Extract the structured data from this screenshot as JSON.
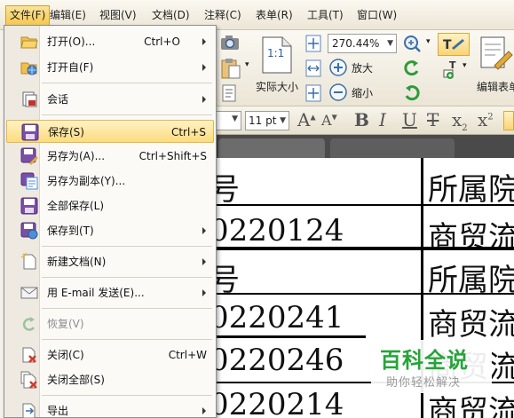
{
  "menubar": {
    "file": "文件(F)",
    "edit": "编辑(E)",
    "view": "视图(V)",
    "document": "文档(D)",
    "comment": "注释(C)",
    "form": "表单(R)",
    "tools": "工具(T)",
    "window": "窗口(W)"
  },
  "file_menu": {
    "open": {
      "label": "打开(O)...",
      "shortcut": "Ctrl+O"
    },
    "open_from": {
      "label": "打开自(F)"
    },
    "session": {
      "label": "会话"
    },
    "save": {
      "label": "保存(S)",
      "shortcut": "Ctrl+S"
    },
    "save_as": {
      "label": "另存为(A)...",
      "shortcut": "Ctrl+Shift+S"
    },
    "save_copy": {
      "label": "另存为副本(Y)..."
    },
    "save_all": {
      "label": "全部保存(L)"
    },
    "save_to": {
      "label": "保存到(T)"
    },
    "new_doc": {
      "label": "新建文档(N)"
    },
    "email": {
      "label": "用 E-mail 发送(E)..."
    },
    "revert": {
      "label": "恢复(V)"
    },
    "close": {
      "label": "关闭(C)",
      "shortcut": "Ctrl+W"
    },
    "close_all": {
      "label": "关闭全部(S)"
    },
    "export": {
      "label": "导出"
    }
  },
  "ribbon": {
    "zoom_value": "270.44%",
    "actual_size_label": "实际大小",
    "zoom_in_label": "放大",
    "zoom_out_label": "缩小",
    "edit_form_label": "编辑表单",
    "page_icon_text": "1:1"
  },
  "format_bar": {
    "font_size": "11 pt"
  },
  "document": {
    "rows": [
      {
        "c1": "号",
        "c2": "所属院"
      },
      {
        "c1": "0220124",
        "c2": "商贸流"
      },
      {
        "c1": "号",
        "c2": "所属院"
      },
      {
        "c1": "0220241",
        "c2": "商贸流"
      },
      {
        "c1": "0220246",
        "c2": "商贸流"
      },
      {
        "c1": "0220214",
        "c2": "商贸流"
      }
    ]
  },
  "watermark": {
    "title": "百科全说",
    "subtitle": "助你轻松解决"
  },
  "colors": {
    "highlight": "#fbdc7d",
    "watermark_green": "#26a43a"
  }
}
